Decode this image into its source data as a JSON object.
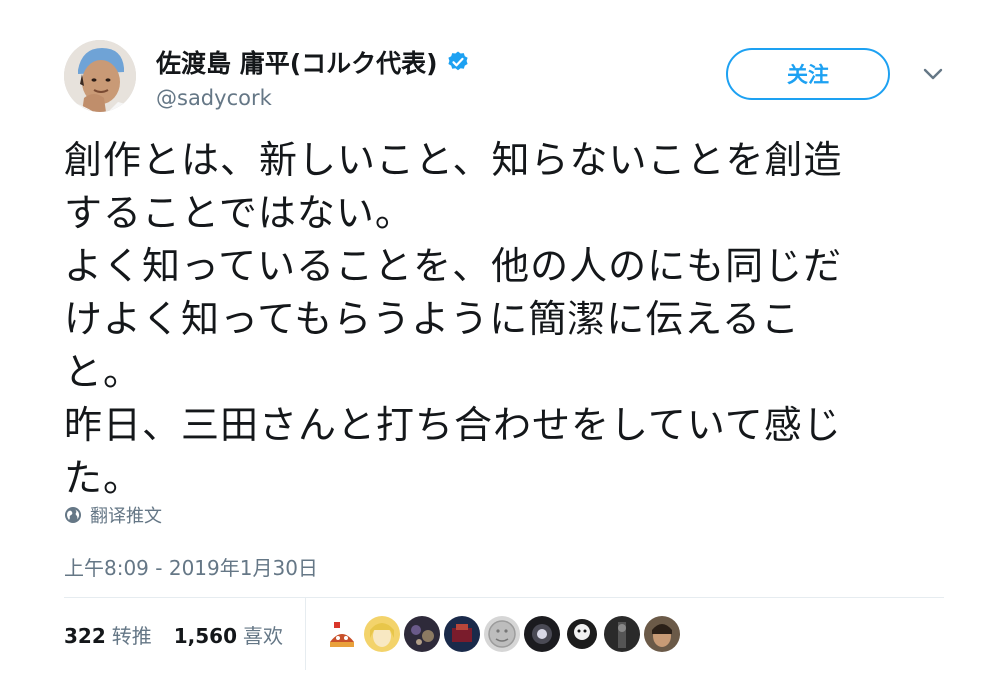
{
  "author": {
    "display_name": "佐渡島 庸平(コルク代表)",
    "handle": "@sadycork",
    "verified": true,
    "avatar_icon": "user-avatar-photo"
  },
  "actions": {
    "follow_label": "关注",
    "menu_icon": "chevron-down-icon"
  },
  "tweet": {
    "lines": [
      "創作とは、新しいこと、知らないことを創造",
      "することではない。",
      "よく知っていることを、他の人のにも同じだ",
      "けよく知ってもらうように簡潔に伝えるこ",
      "と。",
      "昨日、三田さんと打ち合わせをしていて感じ",
      "た。"
    ],
    "translate_label": "翻译推文",
    "timestamp": "上午8:09 - 2019年1月30日"
  },
  "stats": {
    "retweets_count": "322",
    "retweets_label": "转推",
    "likes_count": "1,560",
    "likes_label": "喜欢"
  },
  "likers": [
    "liker-avatar-1",
    "liker-avatar-2",
    "liker-avatar-3",
    "liker-avatar-4",
    "liker-avatar-5",
    "liker-avatar-6",
    "liker-avatar-7",
    "liker-avatar-8",
    "liker-avatar-9"
  ],
  "colors": {
    "accent": "#1da1f2",
    "secondary_text": "#657786",
    "primary_text": "#14171a",
    "divider": "#e6ecf0"
  }
}
